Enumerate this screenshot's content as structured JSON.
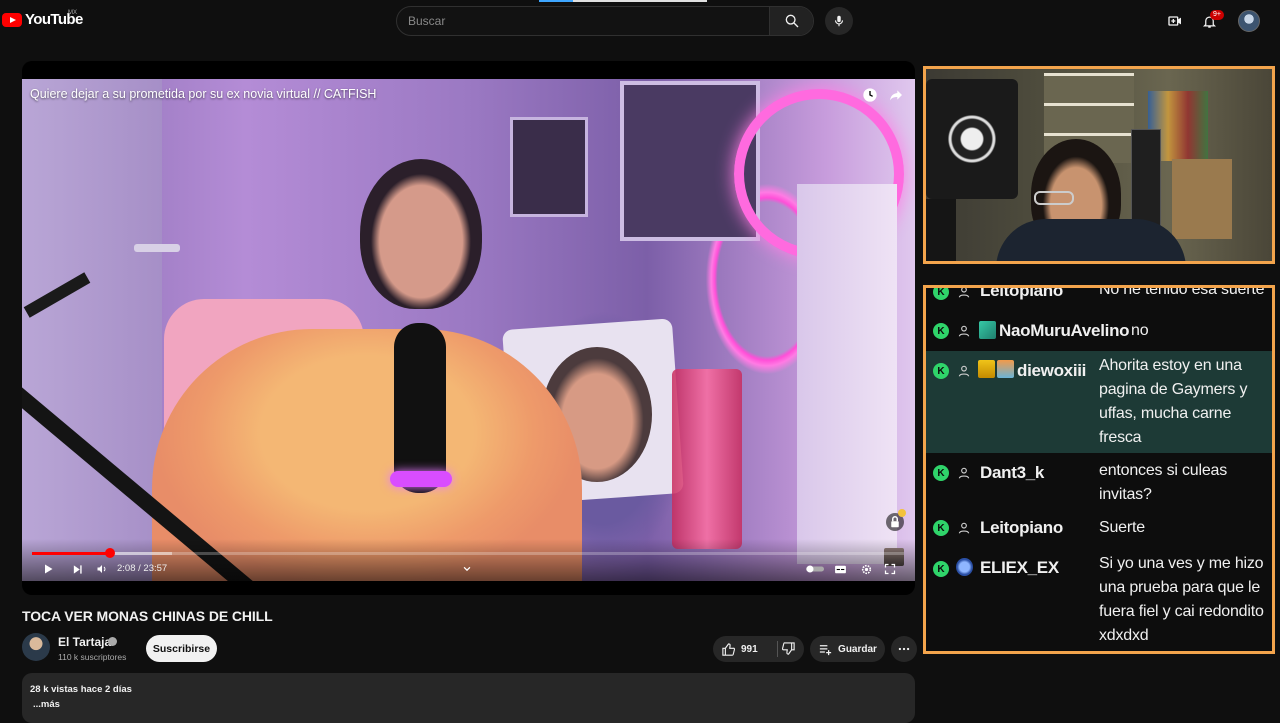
{
  "topbar": {
    "logo_text": "YouTube",
    "logo_region": "MX",
    "search_placeholder": "Buscar",
    "notification_count": "9+",
    "icons": [
      "create-icon",
      "bell-icon",
      "search-icon",
      "mic-icon",
      "avatar"
    ]
  },
  "player": {
    "overlay_title": "Quiere dejar a su prometida por su ex novia virtual // CATFISH",
    "current_time": "2:08",
    "duration": "23:57",
    "time_display": "2:08 / 23:57",
    "progress_fraction": 0.089,
    "buffer_fraction": 0.16
  },
  "video": {
    "title": "TOCA VER MONAS CHINAS DE CHILL",
    "channel_name": "El Tartaja",
    "subscribers": "110 k suscriptores",
    "subscribe_label": "Suscribirse",
    "likes": "991",
    "save_label": "Guardar",
    "stats": "28 k vistas  hace 2 días",
    "more_label": "...más"
  },
  "chat": {
    "accent": "#f3a44c",
    "badge_letter": "K",
    "messages": [
      {
        "user": "Leitopiano",
        "text": "No he tenido esa suerte"
      },
      {
        "user": "NaoMuruAvelino",
        "text": "no"
      },
      {
        "user": "diewoxiii",
        "text": "Ahorita estoy en una pagina de Gaymers y uffas, mucha carne fresca"
      },
      {
        "user": "Dant3_k",
        "text": "entonces si culeas invitas?"
      },
      {
        "user": "Leitopiano",
        "text": "Suerte"
      },
      {
        "user": "ELIEX_EX",
        "text": "Si yo una ves y me hizo una prueba para que le fuera fiel y cai redondito xdxdxd"
      }
    ]
  }
}
